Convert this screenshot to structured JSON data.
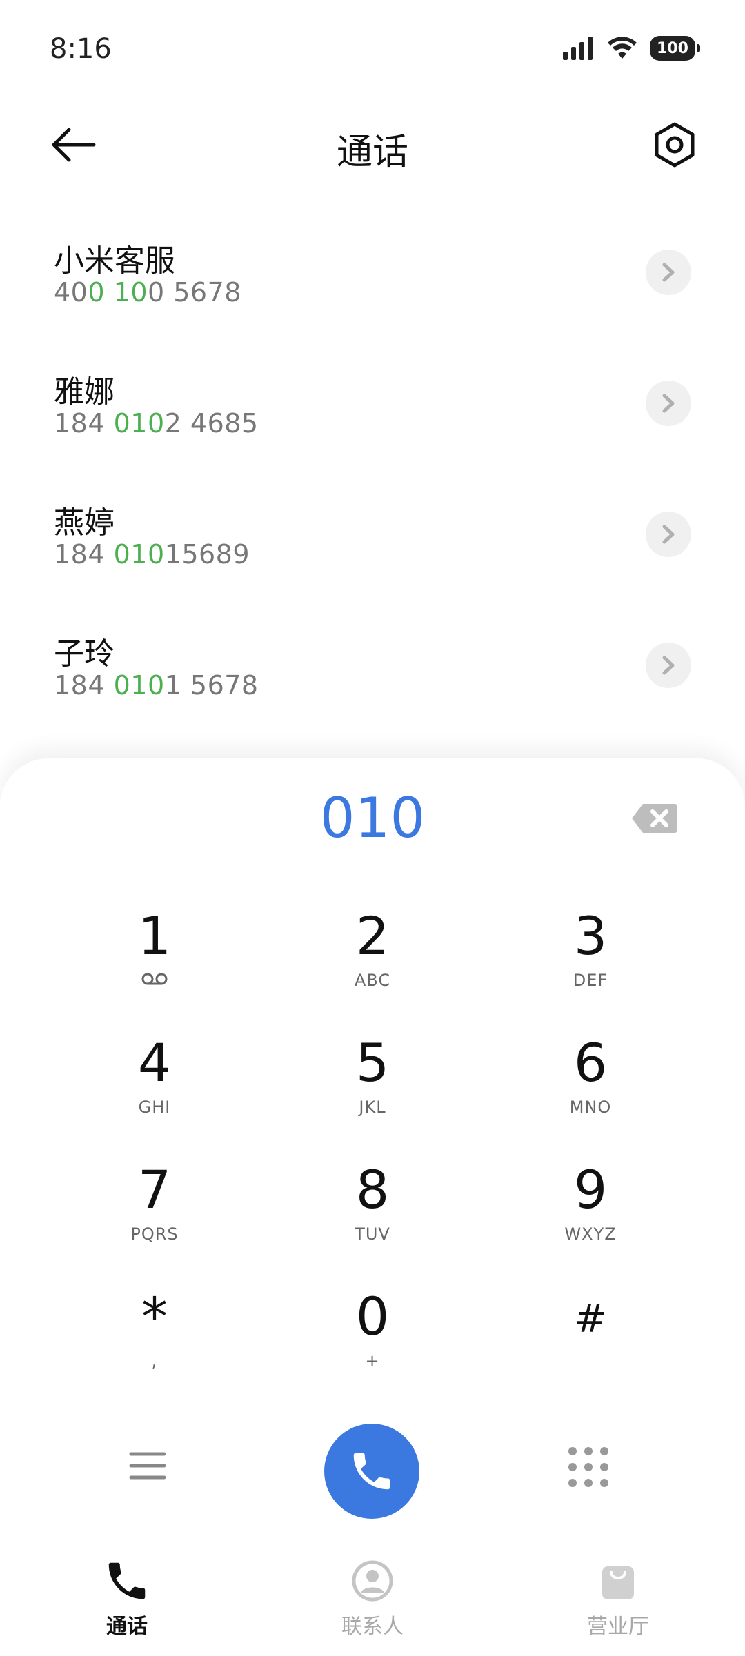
{
  "status_bar": {
    "time": "8:16",
    "battery": "100"
  },
  "header": {
    "title": "通话"
  },
  "results": [
    {
      "name": "小米客服",
      "number_parts": [
        [
          "40",
          false
        ],
        [
          "0",
          true
        ],
        [
          " ",
          false
        ],
        [
          "10",
          true
        ],
        [
          "0 5678",
          false
        ]
      ]
    },
    {
      "name": "雅娜",
      "number_parts": [
        [
          "184 ",
          false
        ],
        [
          "010",
          true
        ],
        [
          "2 4685",
          false
        ]
      ]
    },
    {
      "name": "燕婷",
      "number_parts": [
        [
          "184 ",
          false
        ],
        [
          "010",
          true
        ],
        [
          "15689",
          false
        ]
      ]
    },
    {
      "name": "子玲",
      "number_parts": [
        [
          "184 ",
          false
        ],
        [
          "010",
          true
        ],
        [
          "1 5678",
          false
        ]
      ]
    }
  ],
  "dialpad": {
    "display": "010",
    "keys": [
      {
        "digit": "1",
        "sub": "voicemail-icon"
      },
      {
        "digit": "2",
        "sub": "ABC"
      },
      {
        "digit": "3",
        "sub": "DEF"
      },
      {
        "digit": "4",
        "sub": "GHI"
      },
      {
        "digit": "5",
        "sub": "JKL"
      },
      {
        "digit": "6",
        "sub": "MNO"
      },
      {
        "digit": "7",
        "sub": "PQRS"
      },
      {
        "digit": "8",
        "sub": "TUV"
      },
      {
        "digit": "9",
        "sub": "WXYZ"
      },
      {
        "digit": "*",
        "sub": ","
      },
      {
        "digit": "0",
        "sub": "+"
      },
      {
        "digit": "#",
        "sub": ""
      }
    ]
  },
  "bottom_nav": {
    "items": [
      {
        "label": "通话",
        "icon": "phone-icon",
        "active": true
      },
      {
        "label": "联系人",
        "icon": "contacts-icon",
        "active": false
      },
      {
        "label": "营业厅",
        "icon": "shopping-bag-icon",
        "active": false
      }
    ]
  },
  "colors": {
    "accent": "#3b79e0",
    "match_highlight": "#4caf50"
  }
}
